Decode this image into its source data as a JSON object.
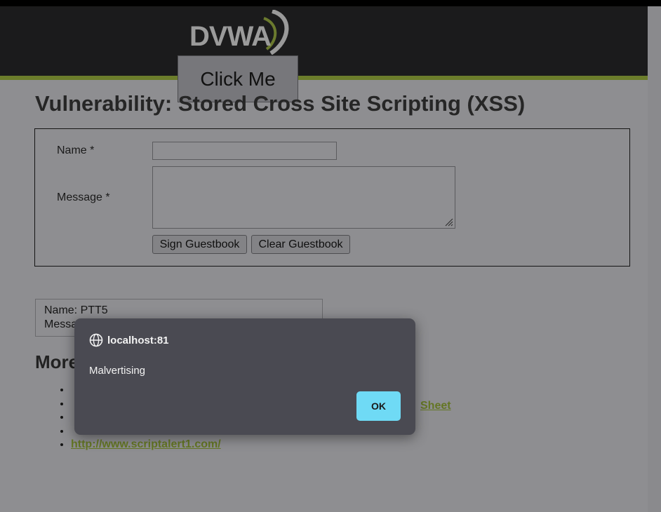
{
  "header": {
    "logo_text": "DVWA",
    "overlay_button": "Click Me"
  },
  "page": {
    "title": "Vulnerability: Stored Cross Site Scripting (XSS)"
  },
  "form": {
    "name_label": "Name *",
    "name_value": "",
    "message_label": "Message *",
    "message_value": "",
    "sign_button": "Sign Guestbook",
    "clear_button": "Clear Guestbook"
  },
  "guestbook": {
    "entry_name": "Name: PTT5",
    "entry_message_partial": "Messa"
  },
  "more_info": {
    "heading_partial": "More",
    "links": [
      {
        "text": "",
        "visible": false
      },
      {
        "text": "",
        "visible": false
      },
      {
        "text": "",
        "visible": false
      },
      {
        "text": "",
        "visible": false
      },
      {
        "text": "http://www.scriptalert1.com/",
        "visible": true
      }
    ],
    "sheet_fragment": "Sheet"
  },
  "dialog": {
    "origin": "localhost:81",
    "message": "Malvertising",
    "ok_label": "OK",
    "icon": "globe-icon"
  },
  "colors": {
    "ok_button": "#6fdaf5",
    "dialog_bg": "#4a4a52",
    "header_accent": "#6c7d2b",
    "link": "#647624"
  }
}
